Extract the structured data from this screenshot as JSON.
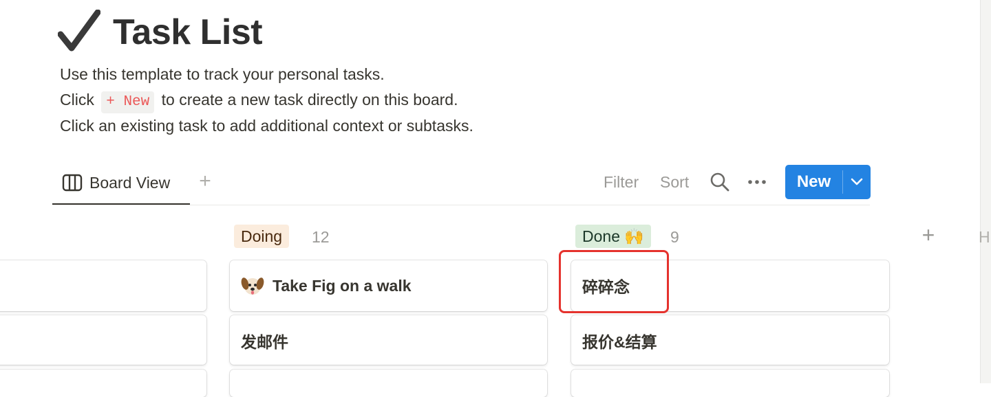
{
  "page": {
    "title": "Task List",
    "title_icon": "checkmark-icon",
    "description": {
      "line1": "Use this template to track your personal tasks.",
      "line2_before": "Click",
      "line2_code": "+ New",
      "line2_after": "to create a new task directly on this board.",
      "line3": "Click an existing task to add additional context or subtasks."
    }
  },
  "toolbar": {
    "view_tab_label": "Board View",
    "view_tab_icon": "board-view-icon",
    "add_view_label": "+",
    "filter_label": "Filter",
    "sort_label": "Sort",
    "search_icon": "search-icon",
    "more_icon": "more-icon",
    "new_button_label": "New",
    "new_button_caret_icon": "chevron-down-icon"
  },
  "board": {
    "groups": [
      {
        "name": "",
        "count": "",
        "cards": [
          {
            "title": ""
          },
          {
            "title": ""
          },
          {
            "title": ""
          }
        ]
      },
      {
        "name": "Doing",
        "count": "12",
        "pill_bg": "#fbecdd",
        "pill_color": "#49290e",
        "cards": [
          {
            "title": "Take Fig on a walk",
            "icon": "dog-face-icon"
          },
          {
            "title": "发邮件"
          },
          {
            "title": ""
          }
        ]
      },
      {
        "name": "Done 🙌",
        "count": "9",
        "pill_bg": "#dbeddb",
        "pill_color": "#1c3829",
        "cards": [
          {
            "title": "碎碎念"
          },
          {
            "title": "报价&结算"
          },
          {
            "title": ""
          }
        ]
      }
    ],
    "add_group_label": "+",
    "hidden_group_label": "H"
  },
  "colors": {
    "accent": "#2383e2",
    "annotation_highlight": "#e5322d",
    "code_text": "#eb5757"
  }
}
